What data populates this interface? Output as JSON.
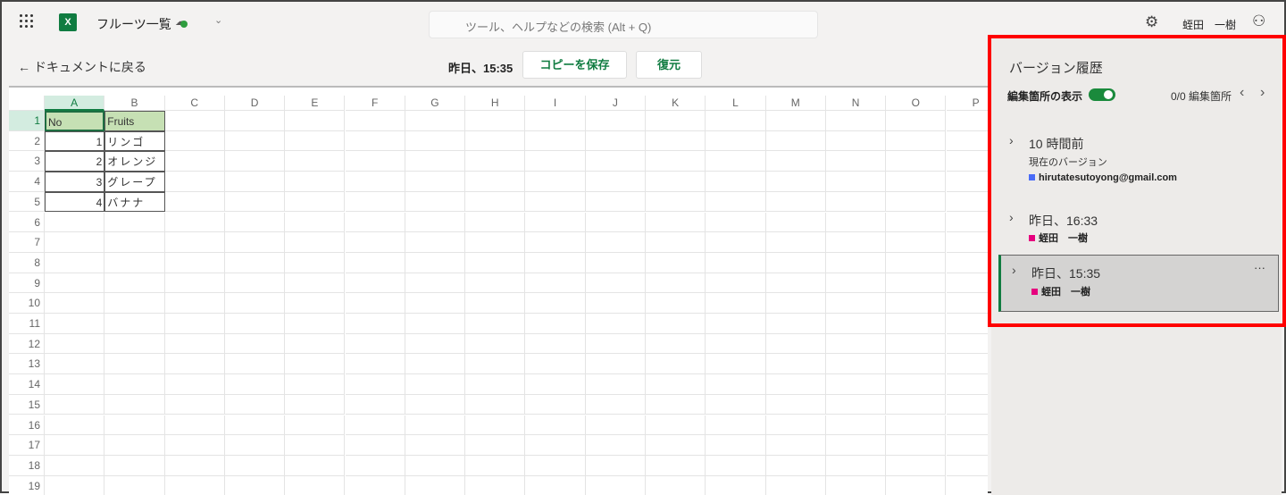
{
  "app": {
    "title": "フルーツ一覧",
    "search_placeholder": "ツール、ヘルプなどの検索 (Alt + Q)",
    "user": "蛭田　一樹",
    "excel_icon": "X"
  },
  "toolbar": {
    "back": "← ドキュメントに戻る",
    "version_label": "昨日、15:35",
    "save_copy": "コピーを保存",
    "restore": "復元"
  },
  "sheet": {
    "columns": [
      "A",
      "B",
      "C",
      "D",
      "E",
      "F",
      "G",
      "H",
      "I",
      "J",
      "K",
      "L",
      "M",
      "N",
      "O",
      "P"
    ],
    "rows": [
      "1",
      "2",
      "3",
      "4",
      "5",
      "6",
      "7",
      "8",
      "9",
      "10",
      "11",
      "12",
      "13",
      "14",
      "15",
      "16",
      "17",
      "18",
      "19"
    ],
    "cells": [
      [
        "No",
        "Fruits"
      ],
      [
        "1",
        "リンゴ"
      ],
      [
        "2",
        "オレンジ"
      ],
      [
        "3",
        "グレープ"
      ],
      [
        "4",
        "バナナ"
      ]
    ]
  },
  "panel": {
    "title": "バージョン履歴",
    "show_changes": "編集箇所の表示",
    "show_changes_on": true,
    "nav": "0/0 編集箇所",
    "versions": [
      {
        "time": "10 時間前",
        "sub": "現在のバージョン",
        "author": "hirutatesutoyong@gmail.com",
        "color": "#4a6cf7"
      },
      {
        "time": "昨日、16:33",
        "author": "蛭田　一樹",
        "color": "#e6007e"
      },
      {
        "time": "昨日、15:35",
        "author": "蛭田　一樹",
        "color": "#e6007e",
        "more": "···",
        "selected": true
      }
    ]
  }
}
